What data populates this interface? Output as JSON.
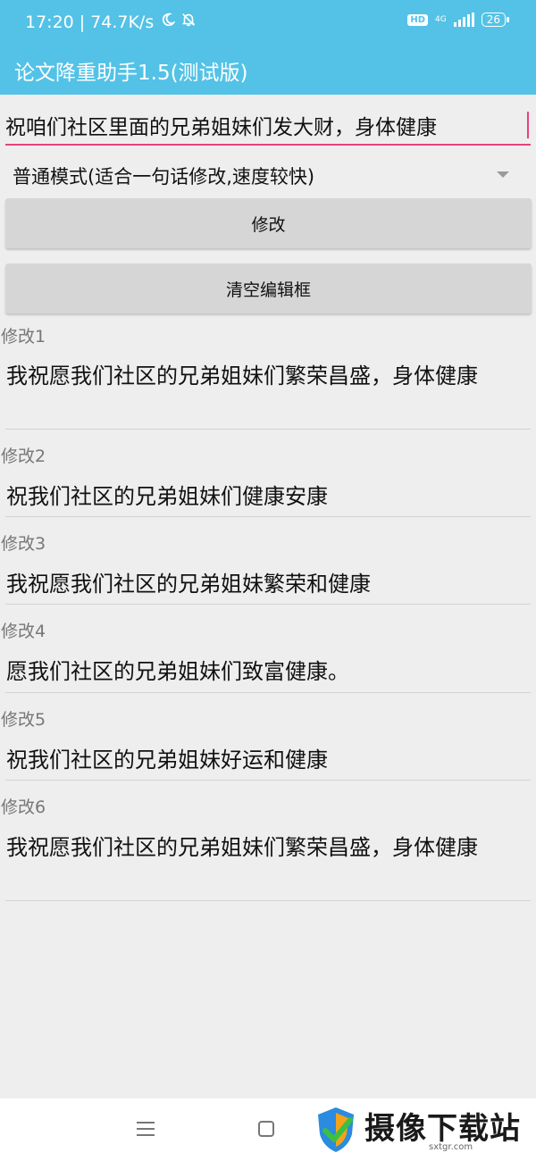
{
  "status": {
    "time": "17:20",
    "speed": "74.7K/s",
    "hd": "HD",
    "net": "4G",
    "battery": "26"
  },
  "app": {
    "title": "论文降重助手1.5(测试版)"
  },
  "input": {
    "value": "祝咱们社区里面的兄弟姐妹们发大财，身体健康"
  },
  "mode": {
    "selected": "普通模式(适合一句话修改,速度较快)"
  },
  "buttons": {
    "modify": "修改",
    "clear": "清空编辑框"
  },
  "results": [
    {
      "label": "修改1",
      "text": "我祝愿我们社区的兄弟姐妹们繁荣昌盛，身体健康"
    },
    {
      "label": "修改2",
      "text": "祝我们社区的兄弟姐妹们健康安康"
    },
    {
      "label": "修改3",
      "text": "我祝愿我们社区的兄弟姐妹繁荣和健康"
    },
    {
      "label": "修改4",
      "text": "愿我们社区的兄弟姐妹们致富健康。"
    },
    {
      "label": "修改5",
      "text": "祝我们社区的兄弟姐妹好运和健康"
    },
    {
      "label": "修改6",
      "text": "我祝愿我们社区的兄弟姐妹们繁荣昌盛，身体健康"
    }
  ],
  "watermark": {
    "text": "摄像下载站",
    "url": "sxtgr.com"
  },
  "colors": {
    "accent": "#53c2e6",
    "underline": "#e8417f",
    "button": "#d6d6d6",
    "background": "#eeeeee"
  }
}
